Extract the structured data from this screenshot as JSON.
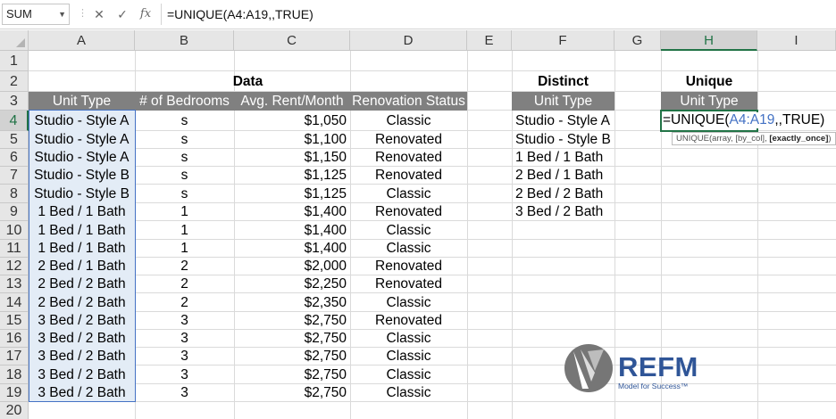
{
  "formula_bar": {
    "name_box": "SUM",
    "cancel_icon": "✕",
    "enter_icon": "✓",
    "fx_label": "fx",
    "formula": "=UNIQUE(A4:A19,,TRUE)"
  },
  "columns": [
    "A",
    "B",
    "C",
    "D",
    "E",
    "F",
    "G",
    "H",
    "I"
  ],
  "rows": [
    "1",
    "2",
    "3",
    "4",
    "5",
    "6",
    "7",
    "8",
    "9",
    "10",
    "11",
    "12",
    "13",
    "14",
    "15",
    "16",
    "17",
    "18",
    "19",
    "20"
  ],
  "data_table": {
    "title": "Data",
    "headers": [
      "Unit Type",
      "# of Bedrooms",
      "Avg. Rent/Month",
      "Renovation Status"
    ],
    "rows": [
      [
        "Studio - Style A",
        "s",
        "$1,050",
        "Classic"
      ],
      [
        "Studio - Style A",
        "s",
        "$1,100",
        "Renovated"
      ],
      [
        "Studio - Style A",
        "s",
        "$1,150",
        "Renovated"
      ],
      [
        "Studio - Style B",
        "s",
        "$1,125",
        "Renovated"
      ],
      [
        "Studio - Style B",
        "s",
        "$1,125",
        "Classic"
      ],
      [
        "1 Bed / 1 Bath",
        "1",
        "$1,400",
        "Renovated"
      ],
      [
        "1 Bed / 1 Bath",
        "1",
        "$1,400",
        "Classic"
      ],
      [
        "1 Bed / 1 Bath",
        "1",
        "$1,400",
        "Classic"
      ],
      [
        "2 Bed / 1 Bath",
        "2",
        "$2,000",
        "Renovated"
      ],
      [
        "2 Bed / 2 Bath",
        "2",
        "$2,250",
        "Renovated"
      ],
      [
        "2 Bed / 2 Bath",
        "2",
        "$2,350",
        "Classic"
      ],
      [
        "3 Bed / 2 Bath",
        "3",
        "$2,750",
        "Renovated"
      ],
      [
        "3 Bed / 2 Bath",
        "3",
        "$2,750",
        "Classic"
      ],
      [
        "3 Bed / 2 Bath",
        "3",
        "$2,750",
        "Classic"
      ],
      [
        "3 Bed / 2 Bath",
        "3",
        "$2,750",
        "Classic"
      ],
      [
        "3 Bed / 2 Bath",
        "3",
        "$2,750",
        "Classic"
      ]
    ]
  },
  "distinct_table": {
    "title": "Distinct",
    "header": "Unit Type",
    "values": [
      "Studio - Style A",
      "Studio - Style B",
      "1 Bed / 1 Bath",
      "2 Bed / 1 Bath",
      "2 Bed / 2 Bath",
      "3 Bed / 2 Bath"
    ]
  },
  "unique_table": {
    "title": "Unique",
    "header": "Unit Type",
    "edit_prefix": "=UNIQUE(",
    "edit_ref": "A4:A19",
    "edit_suffix": ",,TRUE)",
    "tooltip_text": "UNIQUE(array, [by_col], ",
    "tooltip_bold": "[exactly_once]",
    "tooltip_end": ")"
  },
  "logo": {
    "name": "REFM",
    "tagline": "Model for Success™"
  },
  "colors": {
    "header_fill": "#808080",
    "selection_fill": "#e3ecf6",
    "accent_green": "#217346",
    "ref_blue": "#4472c4",
    "logo_blue": "#2f5597"
  }
}
